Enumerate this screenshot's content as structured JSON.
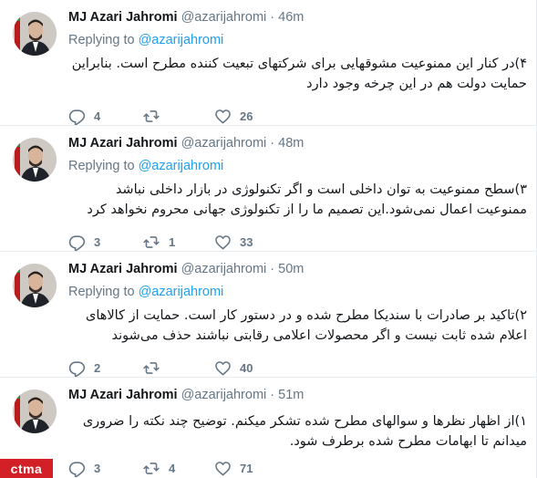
{
  "tweets": [
    {
      "name": "MJ Azari Jahromi",
      "handle": "@azarijahromi",
      "dot": "·",
      "time": "46m",
      "replying_label": "Replying to",
      "replying_to": "@azarijahromi",
      "text": "۴)در کنار این ممنوعیت مشوقهایی برای شرکتهای تبعیت کننده مطرح است. بنابراین حمایت دولت هم در این چرخه وجود دارد",
      "replies": "4",
      "retweets": "",
      "likes": "26"
    },
    {
      "name": "MJ Azari Jahromi",
      "handle": "@azarijahromi",
      "dot": "·",
      "time": "48m",
      "replying_label": "Replying to",
      "replying_to": "@azarijahromi",
      "text": "۳)سطح ممنوعیت به توان داخلی است و اگر تکنولوژی در بازار داخلی نباشد ممنوعیت اعمال نمی‌شود.این تصمیم ما را از تکنولوژی جهانی محروم نخواهد کرد",
      "replies": "3",
      "retweets": "1",
      "likes": "33"
    },
    {
      "name": "MJ Azari Jahromi",
      "handle": "@azarijahromi",
      "dot": "·",
      "time": "50m",
      "replying_label": "Replying to",
      "replying_to": "@azarijahromi",
      "text": "۲)تاکید بر صادرات با سندیکا مطرح شده و در دستور کار است. حمایت از کالاهای اعلام شده ثابت نیست و اگر محصولات اعلامی رقابتی نباشند حذف می‌شوند",
      "replies": "2",
      "retweets": "",
      "likes": "40"
    },
    {
      "name": "MJ Azari Jahromi",
      "handle": "@azarijahromi",
      "dot": "·",
      "time": "51m",
      "replying_label": "",
      "replying_to": "",
      "text": "۱)از اظهار نظرها و سوالهای مطرح شده تشکر میکنم. توضیح چند نکته را ضروری میدانم تا ابهامات مطرح شده برطرف شود.",
      "replies": "3",
      "retweets": "4",
      "likes": "71"
    }
  ],
  "watermark": "ctma",
  "colors": {
    "accent": "#1da1f2",
    "muted": "#657786",
    "text": "#14171a",
    "divider": "#e6ecf0",
    "watermark_bg": "#d32027"
  },
  "icons": {
    "reply": "reply-icon",
    "retweet": "retweet-icon",
    "like": "heart-icon"
  }
}
